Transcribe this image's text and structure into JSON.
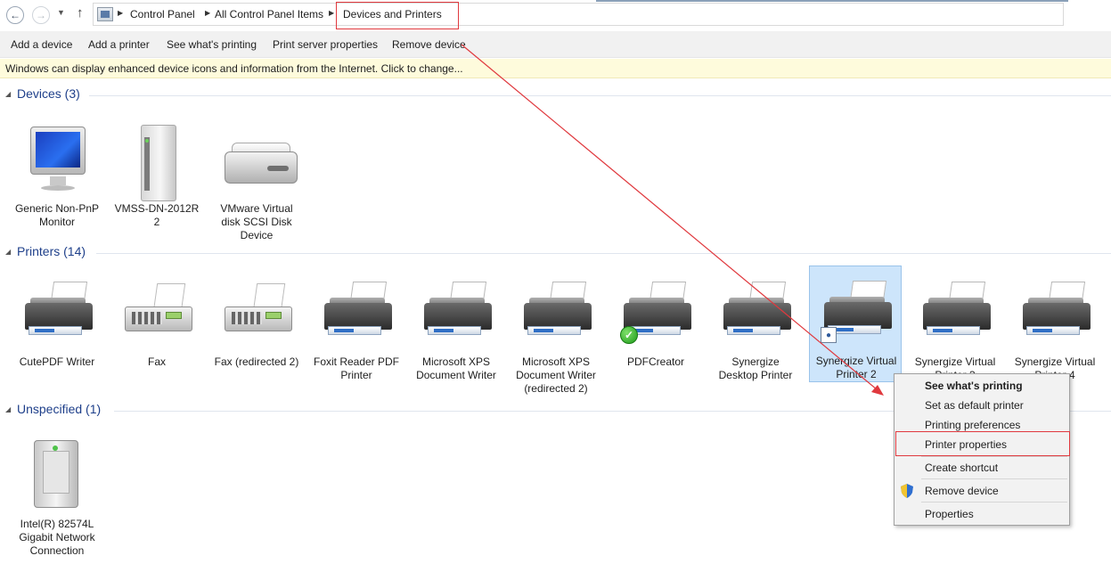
{
  "address_bar": {
    "crumbs": [
      "Control Panel",
      "All Control Panel Items",
      "Devices and Printers"
    ]
  },
  "command_bar": {
    "items": [
      "Add a device",
      "Add a printer",
      "See what's printing",
      "Print server properties",
      "Remove device"
    ]
  },
  "info_bar": {
    "text": "Windows can display enhanced device icons and information from the Internet. Click to change..."
  },
  "groups": {
    "devices": {
      "title": "Devices (3)",
      "items": [
        {
          "line1": "Generic Non-PnP",
          "line2": "Monitor",
          "line3": "",
          "icon": "monitor-icon"
        },
        {
          "line1": "VMSS-DN-2012R",
          "line2": "2",
          "line3": "",
          "icon": "computer-tower-icon"
        },
        {
          "line1": "VMware Virtual",
          "line2": "disk SCSI Disk",
          "line3": "Device",
          "icon": "disk-drive-icon"
        }
      ]
    },
    "printers": {
      "title": "Printers (14)",
      "items": [
        {
          "line1": "CutePDF Writer",
          "line2": "",
          "line3": "",
          "icon": "printer-icon"
        },
        {
          "line1": "Fax",
          "line2": "",
          "line3": "",
          "icon": "fax-icon"
        },
        {
          "line1": "Fax (redirected 2)",
          "line2": "",
          "line3": "",
          "icon": "fax-icon"
        },
        {
          "line1": "Foxit Reader PDF",
          "line2": "Printer",
          "line3": "",
          "icon": "printer-icon"
        },
        {
          "line1": "Microsoft XPS",
          "line2": "Document Writer",
          "line3": "",
          "icon": "printer-icon"
        },
        {
          "line1": "Microsoft XPS",
          "line2": "Document Writer",
          "line3": "(redirected 2)",
          "icon": "printer-icon"
        },
        {
          "line1": "PDFCreator",
          "line2": "",
          "line3": "",
          "icon": "printer-icon",
          "default": true
        },
        {
          "line1": "Synergize",
          "line2": "Desktop Printer",
          "line3": "",
          "icon": "printer-icon"
        },
        {
          "line1": "Synergize Virtual",
          "line2": "Printer 2",
          "line3": "",
          "icon": "printer-icon",
          "selected": true
        },
        {
          "line1": "Synergize Virtual",
          "line2": "Printer 3",
          "line3": "",
          "icon": "printer-icon"
        },
        {
          "line1": "Synergize Virtual",
          "line2": "Printer 4",
          "line3": "",
          "icon": "printer-icon"
        }
      ]
    },
    "unspecified": {
      "title": "Unspecified (1)",
      "items": [
        {
          "line1": "Intel(R) 82574L",
          "line2": "Gigabit Network",
          "line3": "Connection",
          "icon": "network-adapter-icon"
        }
      ]
    }
  },
  "context_menu": {
    "items": [
      {
        "label": "See what's printing",
        "bold": true
      },
      {
        "label": "Set as default printer"
      },
      {
        "label": "Printing preferences"
      },
      {
        "label": "Printer properties",
        "highlighted": true
      },
      {
        "label": "Create shortcut"
      },
      {
        "label": "Remove device",
        "icon": "uac-shield-icon"
      },
      {
        "label": "Properties"
      }
    ]
  },
  "colors": {
    "group_title": "#1e3f8a",
    "selection_fill": "#cde5fb",
    "info_bar": "#fefbdc",
    "annotation_red": "#e0393e"
  }
}
